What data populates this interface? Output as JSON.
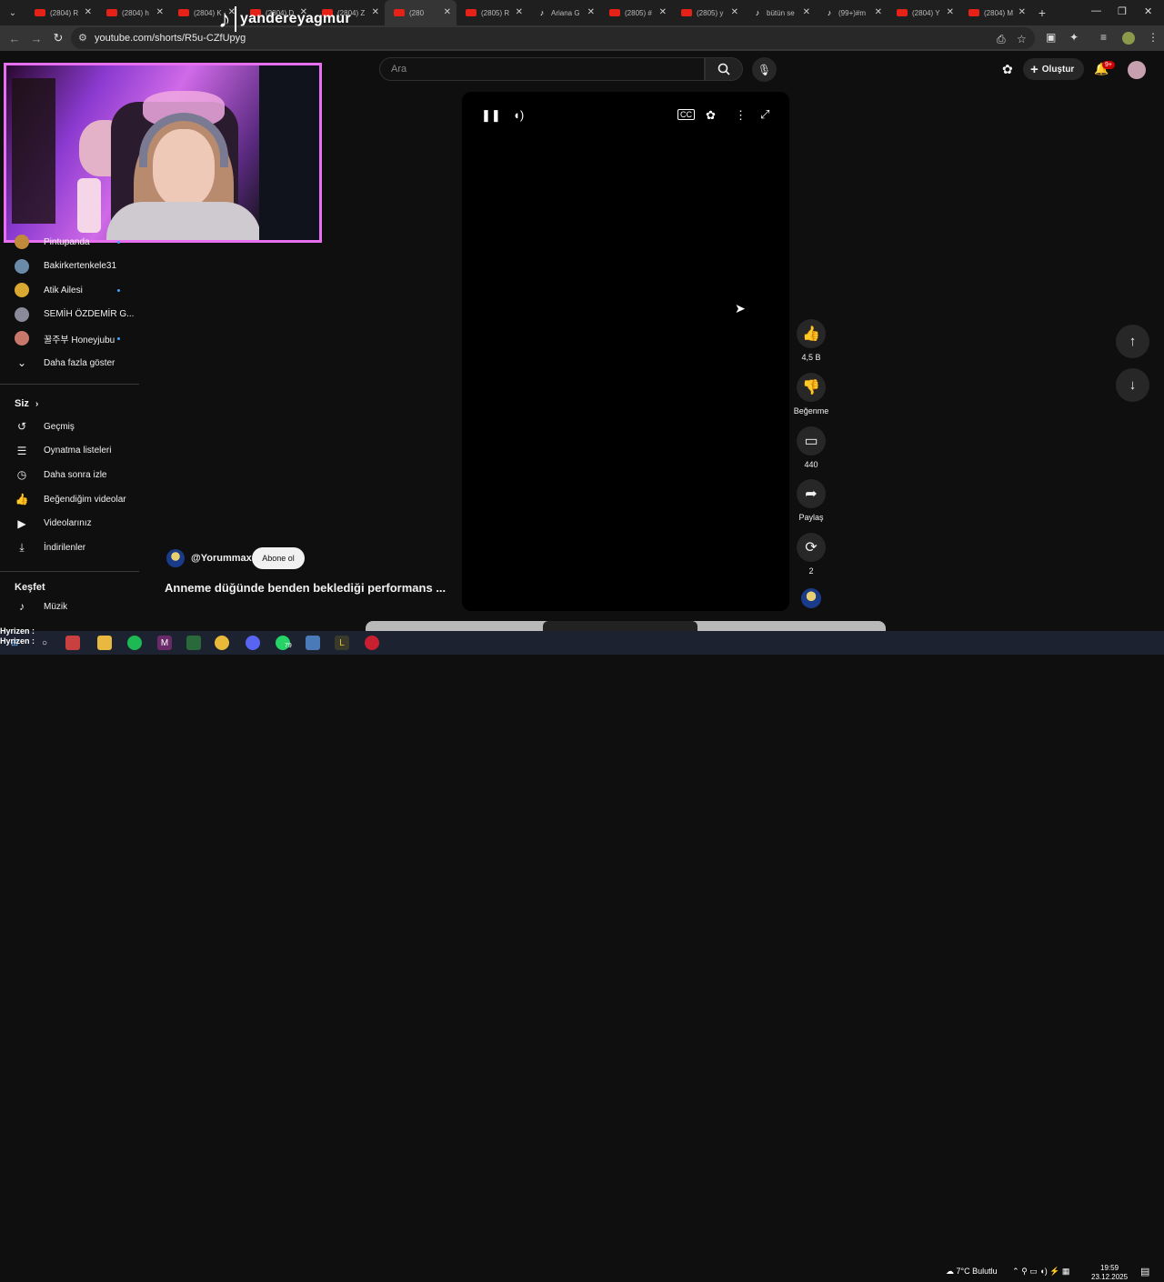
{
  "browser": {
    "tabs": [
      {
        "label": "(2804) R",
        "icon": "youtube-icon"
      },
      {
        "label": "(2804) h",
        "icon": "youtube-icon"
      },
      {
        "label": "(2804) K",
        "icon": "youtube-icon"
      },
      {
        "label": "(2804) D",
        "icon": "youtube-icon"
      },
      {
        "label": "(2804) Z",
        "icon": "youtube-icon"
      },
      {
        "label": "(280",
        "icon": "youtube-icon",
        "active": true
      },
      {
        "label": "(2805) R",
        "icon": "youtube-icon"
      },
      {
        "label": "Ariana G",
        "icon": "tiktok-icon"
      },
      {
        "label": "(2805) #",
        "icon": "youtube-icon"
      },
      {
        "label": "(2805) y",
        "icon": "youtube-icon"
      },
      {
        "label": "bütün se",
        "icon": "tiktok-icon"
      },
      {
        "label": "(99+)#m",
        "icon": "tiktok-icon"
      },
      {
        "label": "(2804) Y",
        "icon": "youtube-icon"
      },
      {
        "label": "(2804) M",
        "icon": "youtube-icon"
      }
    ],
    "url": "youtube.com/shorts/R5u-CZfUpyg"
  },
  "overlay": {
    "tiktok_handle": "yandereyagmur"
  },
  "youtube": {
    "search_placeholder": "Ara",
    "create_label": "Oluştur",
    "notif_count": "9+",
    "sidebar": {
      "subscriptions": [
        {
          "label": "Pintupanda",
          "dot": true,
          "color": "#c08a3a"
        },
        {
          "label": "Bakirkertenkele31",
          "dot": false,
          "color": "#6a8aa8"
        },
        {
          "label": "Atik Ailesi",
          "dot": true,
          "color": "#d8a830"
        },
        {
          "label": "SEMİH ÖZDEMİR G...",
          "dot": false,
          "color": "#8a8a9a"
        },
        {
          "label": "꿀주부 Honeyjubu",
          "dot": true,
          "color": "#c8786a"
        }
      ],
      "show_more": "Daha fazla göster",
      "you_heading": "Siz",
      "you_items": [
        {
          "label": "Geçmiş",
          "icon": "history-icon"
        },
        {
          "label": "Oynatma listeleri",
          "icon": "playlists-icon"
        },
        {
          "label": "Daha sonra izle",
          "icon": "watch-later-icon"
        },
        {
          "label": "Beğendiğim videolar",
          "icon": "liked-videos-icon"
        },
        {
          "label": "Videolarınız",
          "icon": "your-videos-icon"
        },
        {
          "label": "İndirilenler",
          "icon": "downloads-icon"
        }
      ],
      "explore_heading": "Keşfet",
      "explore_items": [
        {
          "label": "Müzik",
          "icon": "music-icon"
        }
      ]
    },
    "short": {
      "channel": "@Yorummax",
      "subscribe_label": "Abone ol",
      "title": "Anneme düğünde benden beklediği performans ...",
      "likes": "4,5 B",
      "dislike_label": "Beğenme",
      "comments": "440",
      "share_label": "Paylaş",
      "remix_count": "2"
    }
  },
  "taskbar": {
    "overlay_lines": [
      "Hyrizen :",
      "Hyrizen :"
    ],
    "badge": "79",
    "weather": "7°C  Bulutlu",
    "time": "19:59",
    "date": "23.12.2025"
  }
}
